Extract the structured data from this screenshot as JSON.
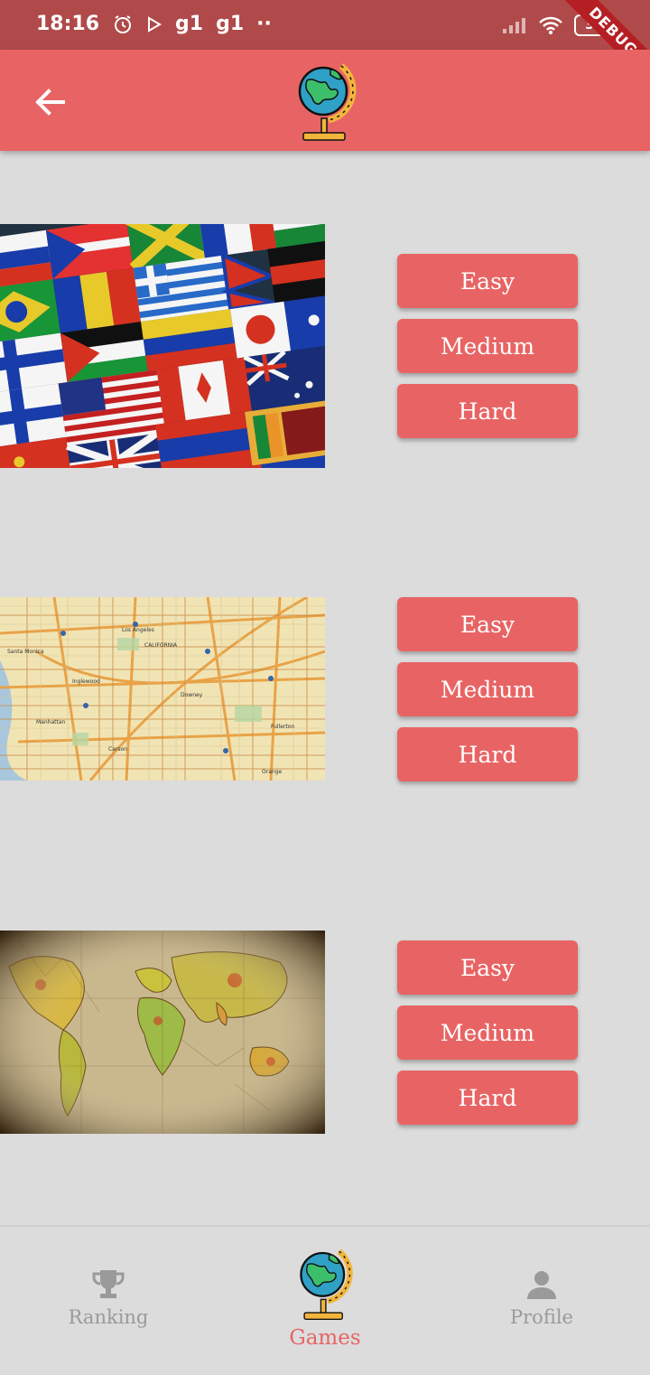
{
  "status_bar": {
    "time": "18:16",
    "notifications": [
      "g1",
      "g1"
    ],
    "more": "··",
    "battery": "38",
    "debug": "DEBUG"
  },
  "app_bar": {
    "back_icon": "arrow-back-icon",
    "logo_icon": "globe-icon"
  },
  "games": [
    {
      "image": "world-flags-collage",
      "buttons": [
        "Easy",
        "Medium",
        "Hard"
      ]
    },
    {
      "image": "city-street-map",
      "buttons": [
        "Easy",
        "Medium",
        "Hard"
      ]
    },
    {
      "image": "vintage-world-map",
      "buttons": [
        "Easy",
        "Medium",
        "Hard"
      ]
    }
  ],
  "bottom_nav": {
    "items": [
      {
        "label": "Ranking",
        "icon": "trophy-icon",
        "active": false
      },
      {
        "label": "Games",
        "icon": "globe-icon",
        "active": true
      },
      {
        "label": "Profile",
        "icon": "person-icon",
        "active": false
      }
    ]
  },
  "colors": {
    "accent": "#e86464",
    "status_bar": "#b04a4a",
    "background": "#dcdcdc",
    "inactive": "#9a9a9a"
  }
}
